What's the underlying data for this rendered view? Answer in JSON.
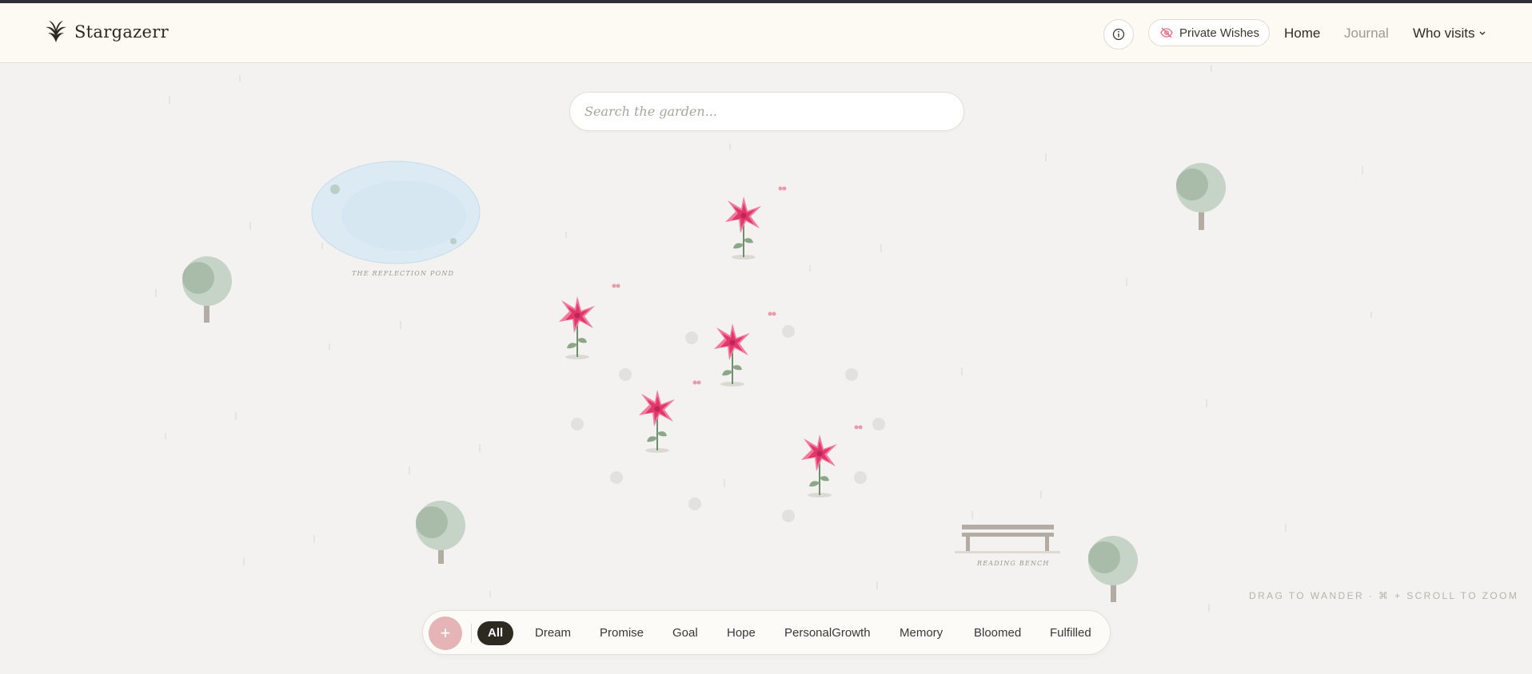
{
  "app": {
    "name": "Stargazerr"
  },
  "header": {
    "private_label": "Private Wishes",
    "nav": {
      "home": "Home",
      "journal": "Journal",
      "who_visits": "Who visits"
    }
  },
  "search": {
    "placeholder": "Search the garden..."
  },
  "garden": {
    "landmarks": {
      "pond": "THE REFLECTION POND",
      "bench": "READING BENCH"
    },
    "flowers_count": 5
  },
  "hint": "DRAG TO WANDER · ⌘ + SCROLL TO ZOOM",
  "filters": {
    "add_symbol": "+",
    "items": [
      "All",
      "Dream",
      "Promise",
      "Goal",
      "Hope",
      "PersonalGrowth",
      "Memory",
      "Bloomed",
      "Fulfilled"
    ],
    "active": "All"
  },
  "colors": {
    "flower": "#ec4f80",
    "pond": "#dbeaf3",
    "tree": "#c5d4c6",
    "add_button": "#e5b4b6",
    "active_chip": "#2d2a22"
  }
}
